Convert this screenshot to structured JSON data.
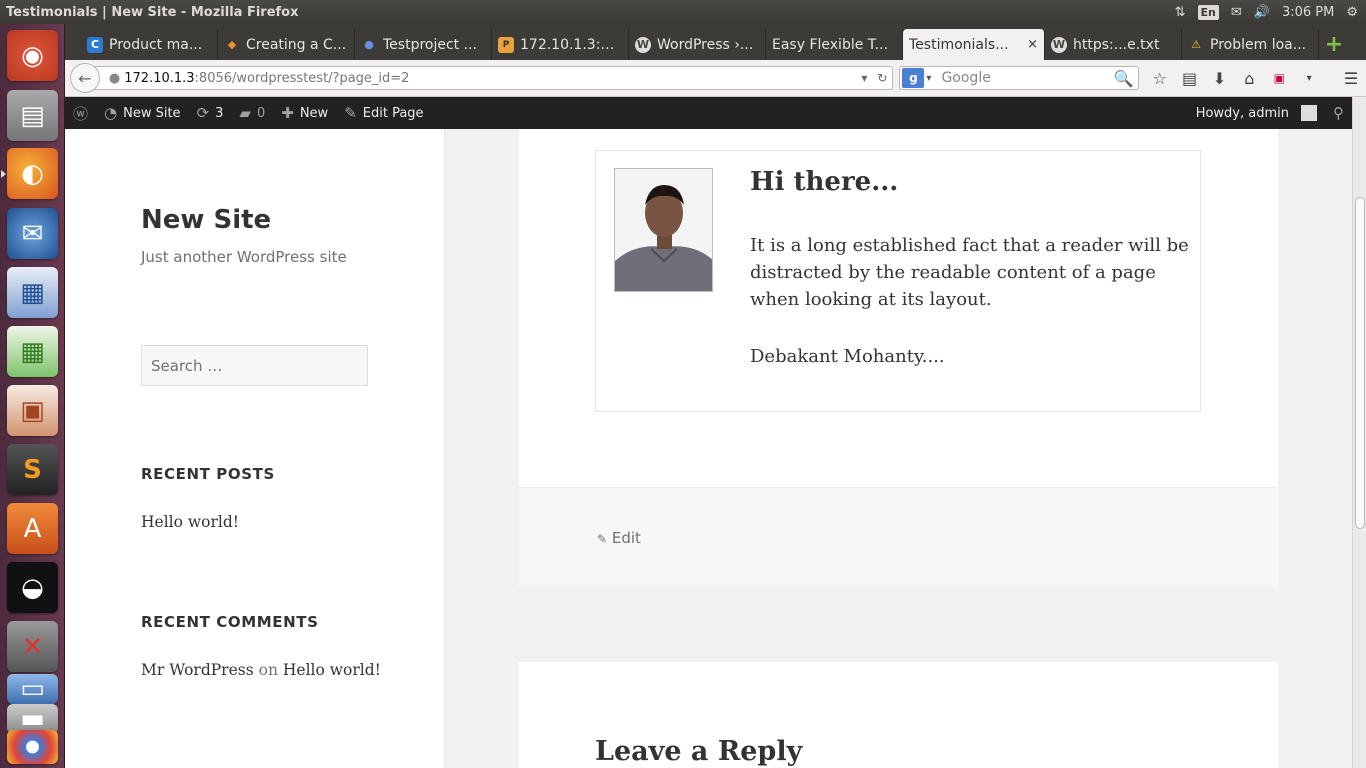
{
  "window": {
    "title": "Testimonials | New Site - Mozilla Firefox"
  },
  "panel": {
    "lang": "En",
    "clock": "3:06 PM"
  },
  "tabs": [
    {
      "label": "Product ma...",
      "fav": "C",
      "fav_color": "#2b7bd1"
    },
    {
      "label": "Creating a C...",
      "fav": "◆",
      "fav_color": "#e8922c"
    },
    {
      "label": "Testproject ...",
      "fav": "●",
      "fav_color": "#3457a8"
    },
    {
      "label": "172.10.1.3:8...",
      "fav": "P",
      "fav_color": "#e9a33a"
    },
    {
      "label": "WordPress ›...",
      "fav": "W",
      "fav_color": "#555555"
    },
    {
      "label": "Easy Flexible T...",
      "fav": "",
      "fav_color": "transparent"
    },
    {
      "label": "Testimonials...",
      "fav": "",
      "fav_color": "transparent",
      "active": true,
      "close": "×"
    },
    {
      "label": "https:...e.txt",
      "fav": "W",
      "fav_color": "#555555"
    },
    {
      "label": "Problem loa...",
      "fav": "⚠",
      "fav_color": "transparent"
    }
  ],
  "newtab": "+",
  "url": {
    "host": "172.10.1.3",
    "path": ":8056/wordpresstest/?page_id=2"
  },
  "search": {
    "engine": "g",
    "placeholder": "Google"
  },
  "adminbar": {
    "site": "New Site",
    "updates": "3",
    "comments": "0",
    "new": "New",
    "edit": "Edit Page",
    "howdy": "Howdy, admin"
  },
  "sidebar": {
    "title": "New Site",
    "tagline": "Just another WordPress site",
    "search_placeholder": "Search …",
    "recent_posts_title": "RECENT POSTS",
    "recent_post": "Hello world!",
    "recent_comments_title": "RECENT COMMENTS",
    "comment_author": "Mr WordPress",
    "comment_on": "on",
    "comment_post": "Hello world!"
  },
  "testimonial": {
    "heading": "Hi there...",
    "body": "It is a long established fact that a reader will be distracted by the readable content of a page when looking at its layout.",
    "author": "Debakant Mohanty...."
  },
  "footer": {
    "edit": "Edit"
  },
  "comments": {
    "title": "Leave a Reply"
  }
}
